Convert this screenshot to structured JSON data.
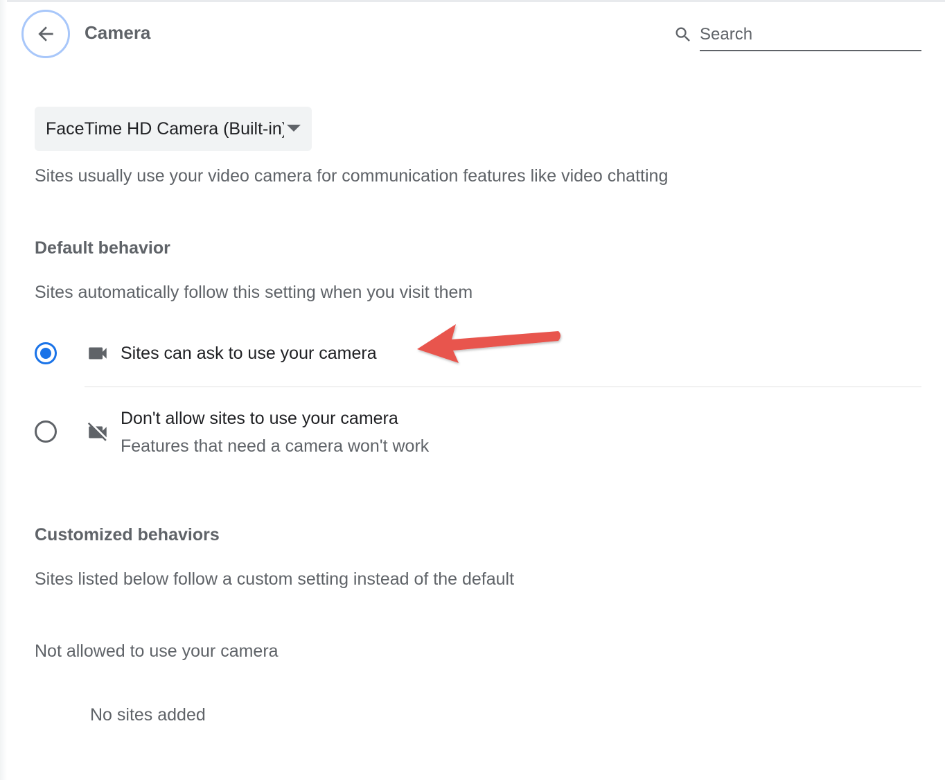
{
  "header": {
    "title": "Camera",
    "search_placeholder": "Search"
  },
  "camera_select": {
    "selected": "FaceTime HD Camera (Built-in)"
  },
  "description": "Sites usually use your video camera for communication features like video chatting",
  "default_behavior": {
    "heading": "Default behavior",
    "subtext": "Sites automatically follow this setting when you visit them",
    "options": [
      {
        "label": "Sites can ask to use your camera",
        "sublabel": "",
        "checked": true,
        "icon": "videocam-icon"
      },
      {
        "label": "Don't allow sites to use your camera",
        "sublabel": "Features that need a camera won't work",
        "checked": false,
        "icon": "videocam-off-icon"
      }
    ]
  },
  "customized_behaviors": {
    "heading": "Customized behaviors",
    "subtext": "Sites listed below follow a custom setting instead of the default",
    "not_allowed_heading": "Not allowed to use your camera",
    "empty_text": "No sites added"
  },
  "colors": {
    "accent": "#1a73e8",
    "annotation_arrow": "#e8554e"
  }
}
